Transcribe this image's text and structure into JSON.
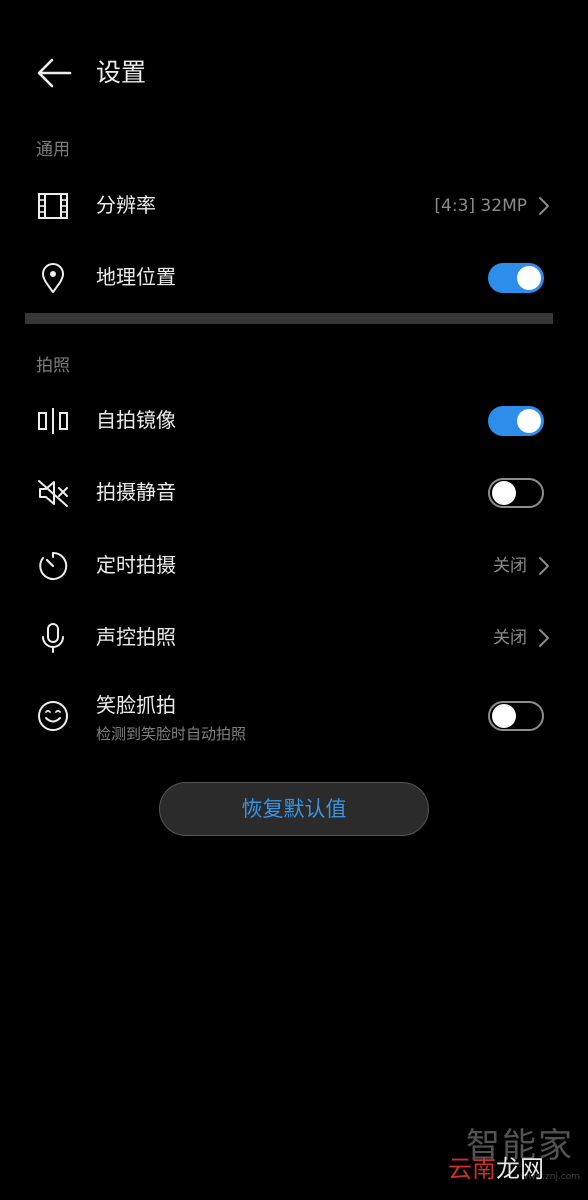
{
  "header": {
    "title": "设置"
  },
  "sections": {
    "general": {
      "title": "通用"
    },
    "photo": {
      "title": "拍照"
    }
  },
  "items": {
    "resolution": {
      "label": "分辨率",
      "value": "[4:3] 32MP",
      "icon": "film-frame-icon"
    },
    "location": {
      "label": "地理位置",
      "toggle": true,
      "icon": "location-pin-icon"
    },
    "mirror": {
      "label": "自拍镜像",
      "toggle": true,
      "icon": "mirror-icon"
    },
    "mute": {
      "label": "拍摄静音",
      "toggle": false,
      "icon": "speaker-muted-icon"
    },
    "timer": {
      "label": "定时拍摄",
      "value": "关闭",
      "icon": "timer-icon"
    },
    "voice": {
      "label": "声控拍照",
      "value": "关闭",
      "icon": "microphone-icon"
    },
    "smile": {
      "label": "笑脸抓拍",
      "sub_label": "检测到笑脸时自动拍照",
      "toggle": false,
      "icon": "smile-icon"
    }
  },
  "reset_button": {
    "label": "恢复默认值"
  },
  "watermark": {
    "top_text": "智能家",
    "accent_text": "云南",
    "main_text": "龙网",
    "url_text": "www.znj.com"
  },
  "colors": {
    "background": "#000000",
    "accent_blue": "#2C8DEA",
    "reset_text": "#3A93E5",
    "secondary_text": "#8A8A8A",
    "divider": "#373737"
  }
}
